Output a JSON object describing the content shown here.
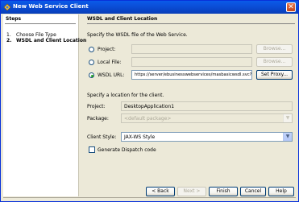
{
  "window": {
    "title": "New Web Service Client",
    "close_glyph": "✕"
  },
  "steps": {
    "title": "Steps",
    "items": [
      {
        "num": "1.",
        "label": "Choose File Type"
      },
      {
        "num": "2.",
        "label": "WSDL and Client Location"
      }
    ]
  },
  "main": {
    "section_title": "WSDL and Client Location",
    "wsdl_instruction": "Specify the WSDL file of the Web Service.",
    "project_option": {
      "label": "Project:",
      "value": "",
      "button": "Browse..."
    },
    "local_file_option": {
      "label": "Local File:",
      "value": "",
      "button": "Browse..."
    },
    "wsdl_url_option": {
      "label": "WSDL URL:",
      "value": "https://server/ebusinesswebservices/masbasicwsdl.svc?wsdl",
      "button": "Set Proxy..."
    },
    "location_instruction": "Specify a location for the client.",
    "project_label": "Project:",
    "project_value": "DesktopApplication1",
    "package_label": "Package:",
    "package_value": "<default package>",
    "client_style_label": "Client Style:",
    "client_style_value": "JAX-WS Style",
    "dispatch_label": "Generate Dispatch code"
  },
  "footer": {
    "back": "< Back",
    "next": "Next >",
    "finish": "Finish",
    "cancel": "Cancel",
    "help": "Help"
  },
  "colors": {
    "titlebar": "#0a5be9",
    "dialog_bg": "#ece9d8",
    "radio_selected": "#21a121"
  }
}
